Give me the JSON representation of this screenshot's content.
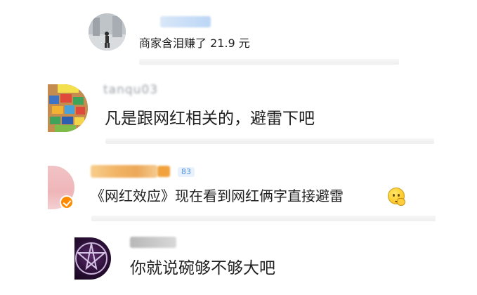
{
  "comments": [
    {
      "username": "",
      "text": "商家含泪赚了 21.9 元",
      "avatar_icon": "photo-avatar-icon"
    },
    {
      "username": "tanqu03",
      "text": "凡是跟网红相关的，避雷下吧",
      "avatar_icon": "toy-blocks-avatar-icon"
    },
    {
      "username": "",
      "text": "《网红效应》现在看到网红俩字直接避雷",
      "avatar_icon": "pink-avatar-icon",
      "level_badge": "83",
      "emoji": "thinking-face-icon"
    },
    {
      "username": "",
      "text": "你就说碗够不够大吧",
      "avatar_icon": "pentagram-avatar-icon"
    }
  ],
  "colors": {
    "text": "#1f1f1f",
    "username": "#9aa0a6",
    "divider": "#efefef",
    "verified_badge": "#ff8a00",
    "level_badge": "#4d8fe0"
  }
}
